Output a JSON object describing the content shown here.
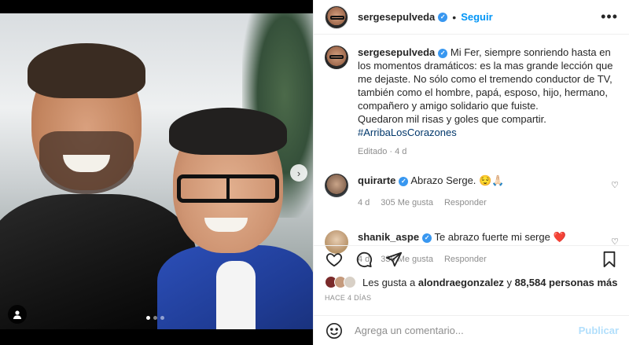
{
  "post": {
    "username": "sergesepulveda",
    "follow_label": "Seguir",
    "more_label": "•••",
    "caption_username": "sergesepulveda",
    "caption_text": "Mi Fer, siempre sonriendo hasta en los momentos dramáticos: es la mas grande lección que me dejaste. No sólo como el tremendo conductor de TV, también como el hombre, papá, esposo, hijo, hermano, compañero y amigo solidario que fuiste.",
    "caption_text_2": "Quedaron mil risas y goles que compartir.",
    "hashtag": "#ArribaLosCorazones",
    "edited": "Editado · 4 d"
  },
  "comments": [
    {
      "username": "quirarte",
      "text": "Abrazo Serge. 😌🙏🏻",
      "age": "4 d",
      "likes": "305 Me gusta",
      "reply": "Responder"
    },
    {
      "username": "shanik_aspe",
      "text": "Te abrazo fuerte mi serge ❤️",
      "age": "4 d",
      "likes": "335 Me gusta",
      "reply": "Responder"
    }
  ],
  "likes_line": {
    "prefix": "Les gusta a",
    "user": "alondraegonzalez",
    "middle": "y",
    "count": "88,584 personas más"
  },
  "time_ago": "HACE 4 DÍAS",
  "add_comment": {
    "placeholder": "Agrega un comentario...",
    "publish": "Publicar"
  },
  "colors": {
    "link_blue": "#0095f6",
    "verified": "#3897f0",
    "publish_disabled": "#b2dffc",
    "heart_red": "#ed4956"
  },
  "carousel": {
    "slides": 3,
    "active": 1
  }
}
